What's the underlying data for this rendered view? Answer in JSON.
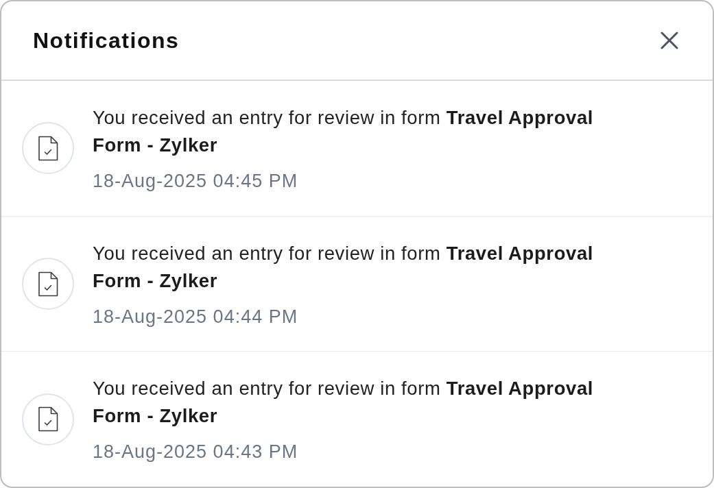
{
  "header": {
    "title": "Notifications"
  },
  "notifications": [
    {
      "message": "You received an entry for review in form **Travel Approval Form - Zylker**",
      "time": "18-Aug-2025 04:45 PM"
    },
    {
      "message": "You received an entry for review in form **Travel Approval Form - Zylker**",
      "time": "18-Aug-2025 04:44 PM"
    },
    {
      "message": "You received an entry for review in form **Travel Approval Form - Zylker**",
      "time": "18-Aug-2025 04:43 PM"
    }
  ]
}
